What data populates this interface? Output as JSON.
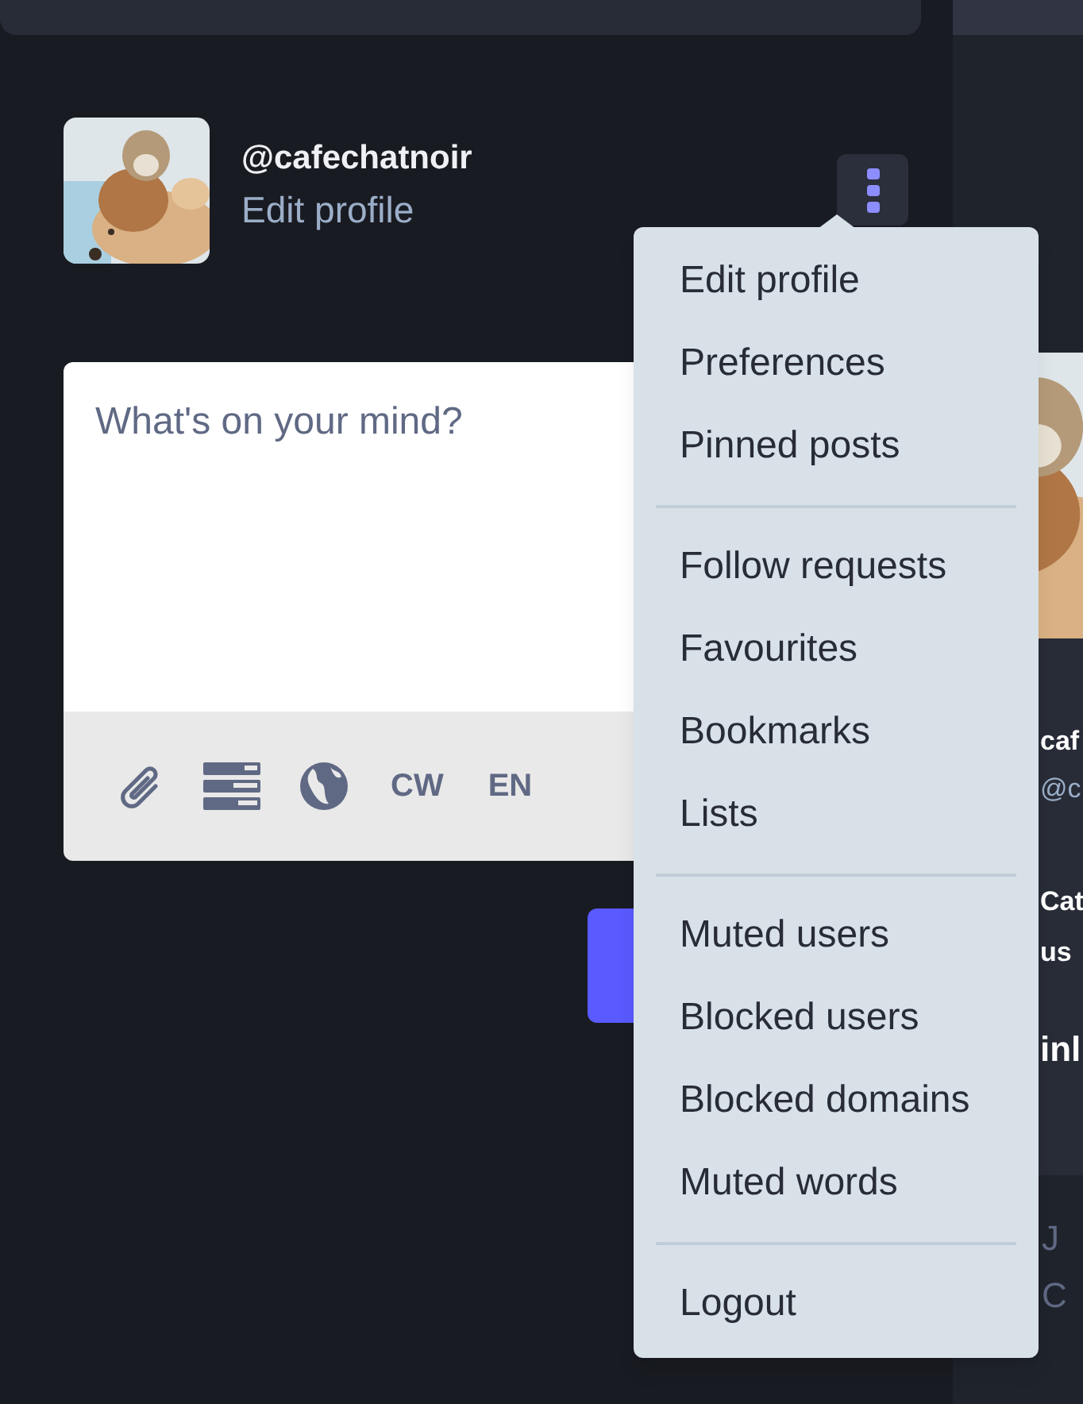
{
  "profile": {
    "handle": "@cafechatnoir",
    "edit_link": "Edit profile"
  },
  "compose": {
    "placeholder": "What's on your mind?",
    "tools": [
      {
        "kind": "attach"
      },
      {
        "kind": "poll"
      },
      {
        "kind": "globe"
      },
      {
        "kind": "text",
        "label": "CW"
      },
      {
        "kind": "text",
        "label": "EN"
      }
    ]
  },
  "menu": {
    "groups": [
      [
        "Edit profile",
        "Preferences",
        "Pinned posts"
      ],
      [
        "Follow requests",
        "Favourites",
        "Bookmarks",
        "Lists"
      ],
      [
        "Muted users",
        "Blocked users",
        "Blocked domains",
        "Muted words"
      ],
      [
        "Logout"
      ]
    ]
  },
  "side_card": {
    "name": "caf",
    "handle": "@c",
    "bio": [
      "Cat",
      "us"
    ],
    "link": "inl"
  },
  "side_footer": [
    "J",
    "C"
  ]
}
